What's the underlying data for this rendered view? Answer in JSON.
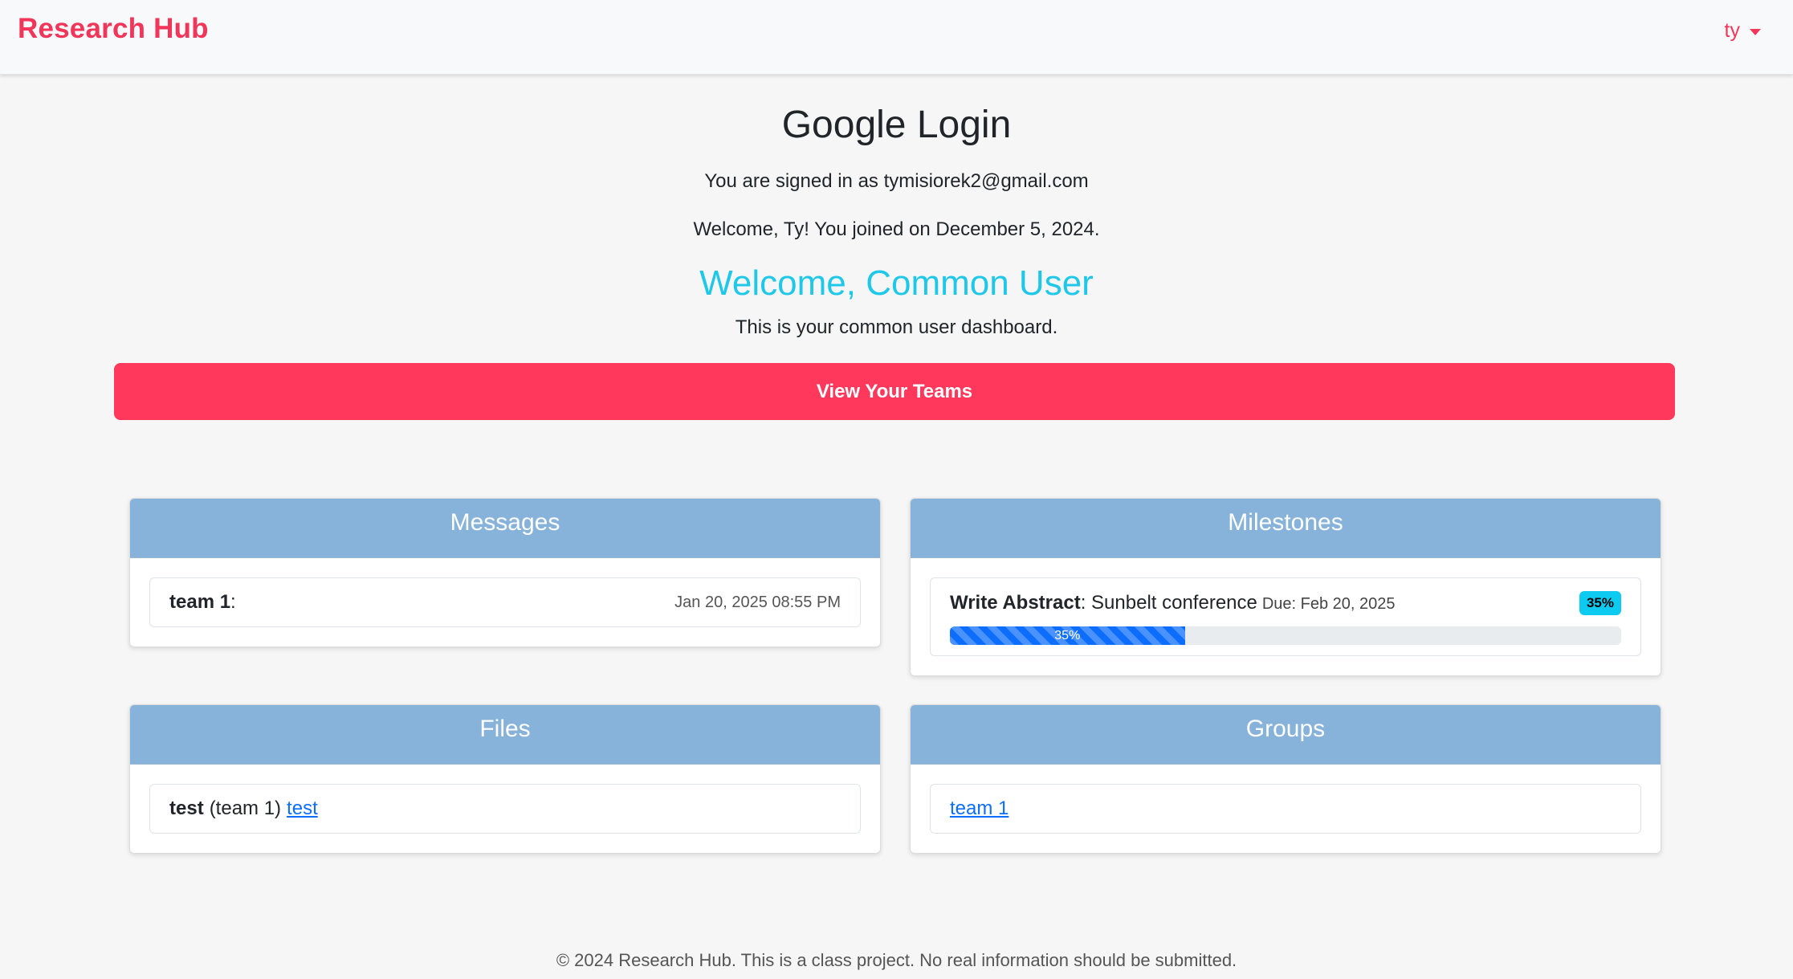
{
  "navbar": {
    "brand": "Research Hub",
    "user_menu_label": "ty"
  },
  "header": {
    "title": "Google Login",
    "signed_in_text": "You are signed in as tymisiorek2@gmail.com",
    "welcome_text": "Welcome, Ty! You joined on December 5, 2024.",
    "role_heading": "Welcome, Common User",
    "dashboard_desc": "This is your common user dashboard."
  },
  "actions": {
    "view_teams_label": "View Your Teams"
  },
  "messages": {
    "title": "Messages",
    "items": [
      {
        "team": "team 1",
        "separator": ":",
        "timestamp": "Jan 20, 2025 08:55 PM"
      }
    ]
  },
  "milestones": {
    "title": "Milestones",
    "items": [
      {
        "name": "Write Abstract",
        "separator": ": ",
        "description": "Sunbelt conference",
        "due": "Due: Feb 20, 2025",
        "badge": "35%",
        "progress_label": "35%",
        "progress_fraction": 0.35
      }
    ]
  },
  "files": {
    "title": "Files",
    "items": [
      {
        "name": "test",
        "team": "(team 1)",
        "link_text": "test"
      }
    ]
  },
  "groups": {
    "title": "Groups",
    "items": [
      {
        "link_text": "team 1"
      }
    ]
  },
  "footer": {
    "text": "© 2024 Research Hub. This is a class project. No real information should be submitted."
  },
  "colors": {
    "brand": "#f1365a",
    "primary_button": "#ff385c",
    "card_header": "#87b2da",
    "role_heading": "#1fc8e8",
    "progress": "#0d6efd",
    "badge": "#0dcaf0"
  }
}
